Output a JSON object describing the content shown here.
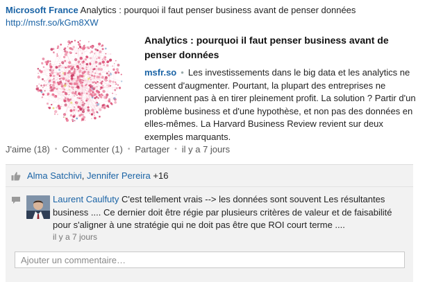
{
  "post": {
    "author": "Microsoft France",
    "headline": "Analytics : pourquoi il faut penser business avant de penser données",
    "url": "http://msfr.so/kGm8XW"
  },
  "card": {
    "title": "Analytics : pourquoi il faut penser business avant de penser données",
    "source": "msfr.so",
    "separator": "•",
    "description": "Les investissements dans le big data et les analytics ne cessent d'augmenter. Pourtant, la plupart des entreprises ne parviennent pas à en tirer pleinement profit. La solution ? Partir d'un problème business et d'une hypothèse, et non pas des données en elles-mêmes. La Harvard Business Review revient sur deux exemples marquants.",
    "thumbnail_icon": "network-graph-image"
  },
  "actions": {
    "like": "J'aime (18)",
    "comment": "Commenter (1)",
    "share": "Partager",
    "time": "il y a 7 jours",
    "dot": "•"
  },
  "likes": {
    "icon": "thumbs-up-icon",
    "names": [
      {
        "name": "Alma Satchivi",
        "comma": ", "
      },
      {
        "name": "Jennifer Pereira",
        "comma": ""
      }
    ],
    "more": "+16"
  },
  "comments": [
    {
      "author": "Laurent Caulfuty",
      "text": "C'est tellement vrais --> les données sont souvent Les résultantes business .... Ce dernier doit être régie par plusieurs critères de valeur et de faisabilité pour s'aligner à une stratégie qui ne doit pas être que ROI court terme ....",
      "time": "il y a 7 jours"
    }
  ],
  "comment_input": {
    "placeholder": "Ajouter un commentaire…"
  },
  "colors": {
    "link": "#1a63a5",
    "panel": "#f2f2f2",
    "thumbnail_accent": "#e25a80"
  }
}
